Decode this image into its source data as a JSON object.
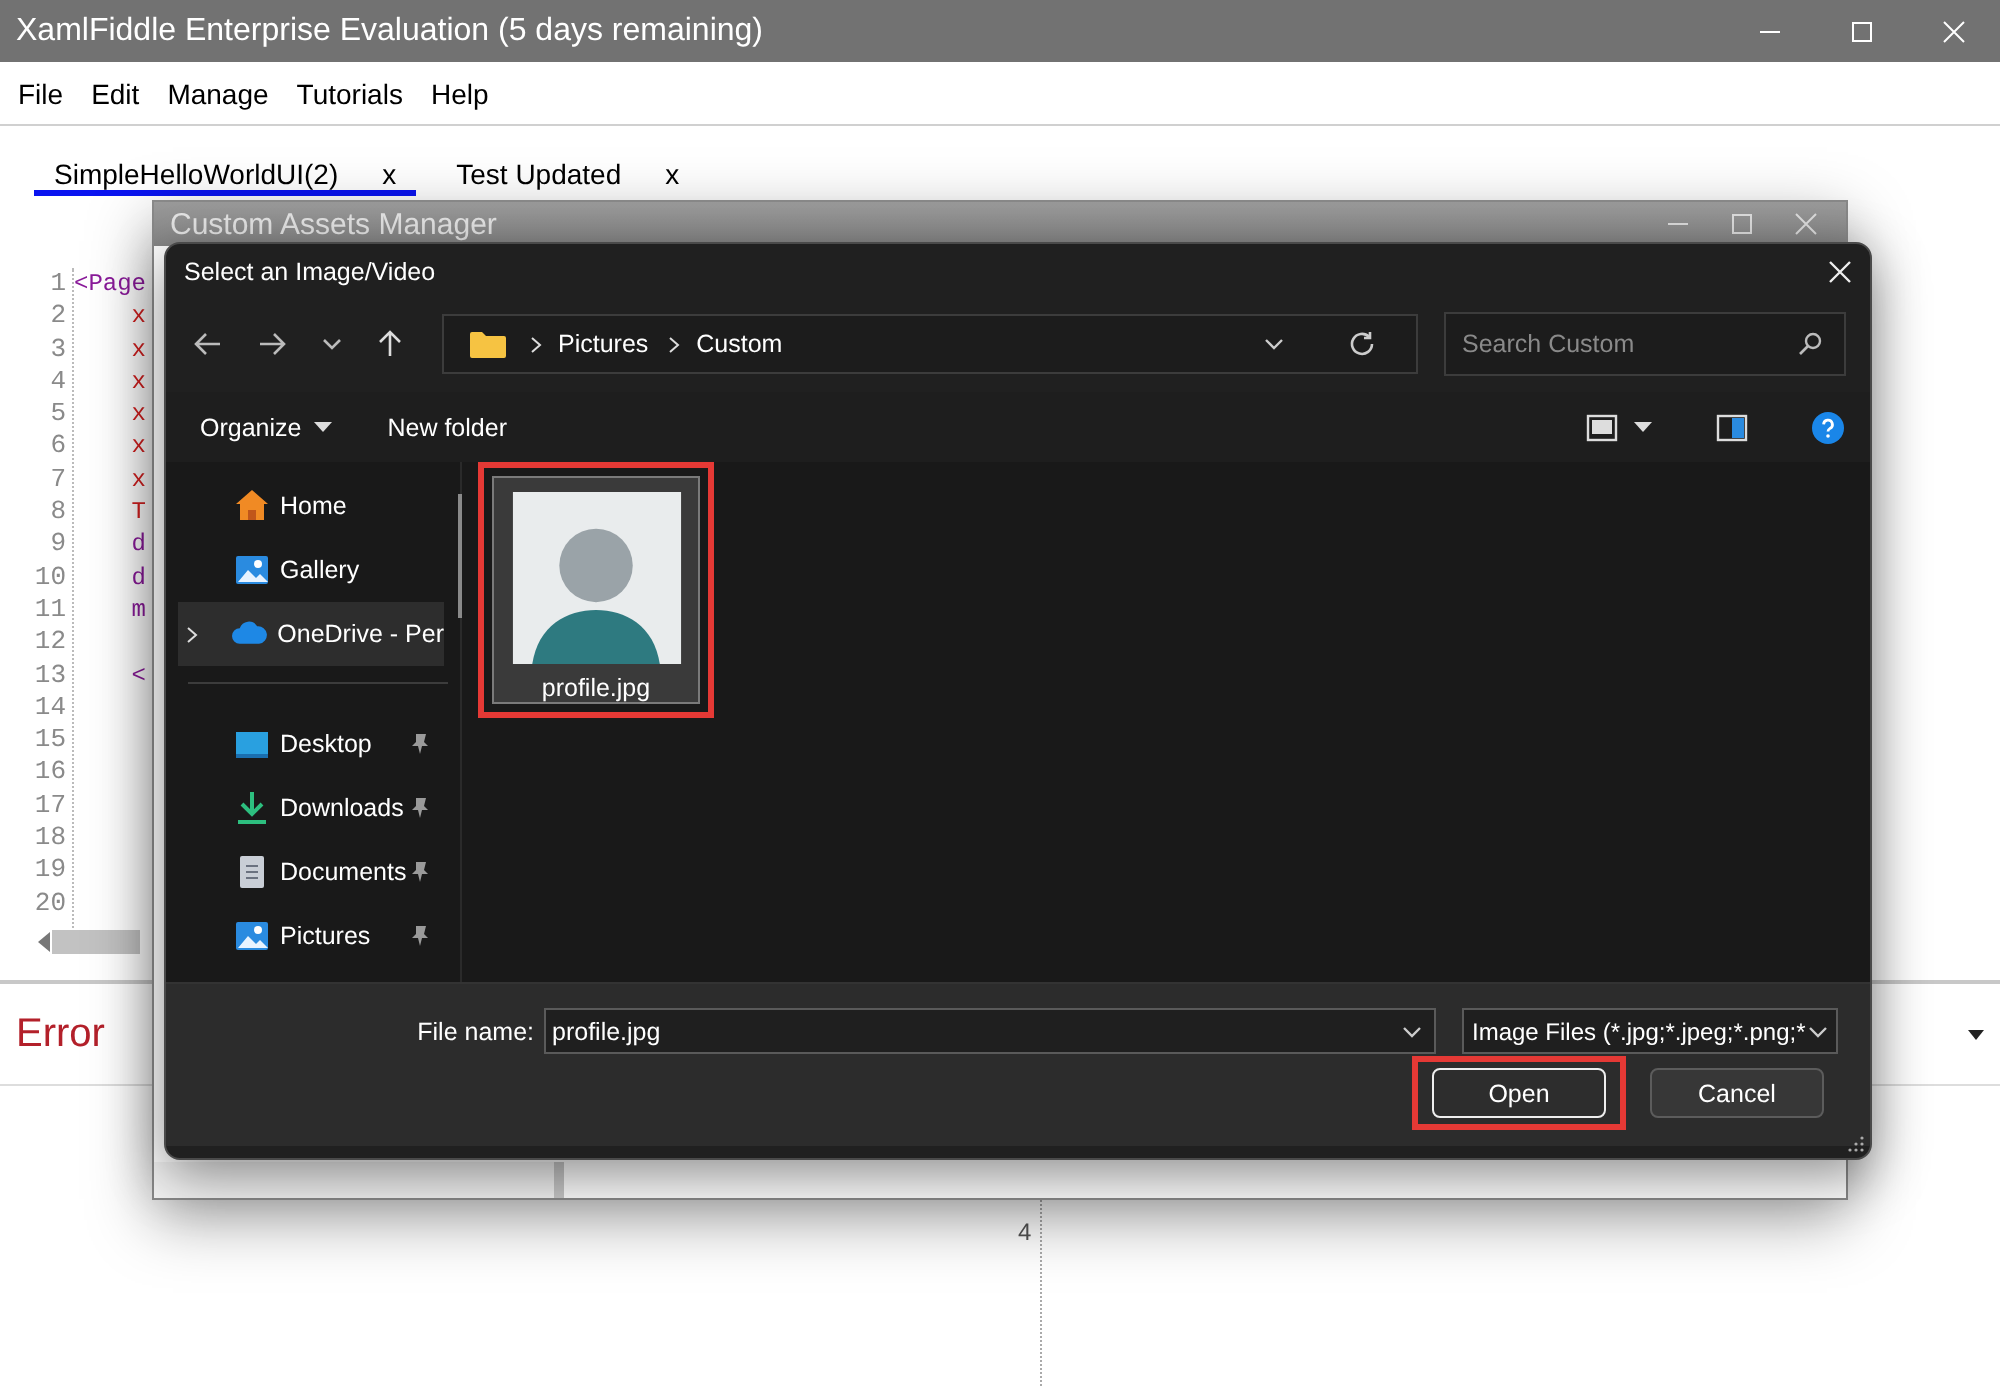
{
  "window": {
    "title": "XamlFiddle Enterprise Evaluation (5 days remaining)"
  },
  "menu": [
    "File",
    "Edit",
    "Manage",
    "Tutorials",
    "Help"
  ],
  "tabs": [
    {
      "label": "SimpleHelloWorldUI(2)",
      "close": "x",
      "selected": true
    },
    {
      "label": "Test Updated",
      "close": "x",
      "selected": false
    }
  ],
  "editor": {
    "lines": [
      {
        "number": "1",
        "code": "<Page",
        "kind": "tag"
      },
      {
        "number": "2",
        "code": "    x",
        "kind": "attribute"
      },
      {
        "number": "3",
        "code": "    x",
        "kind": "attribute"
      },
      {
        "number": "4",
        "code": "    x",
        "kind": "attribute"
      },
      {
        "number": "5",
        "code": "    x",
        "kind": "attribute"
      },
      {
        "number": "6",
        "code": "    x",
        "kind": "attribute"
      },
      {
        "number": "7",
        "code": "    x",
        "kind": "attribute"
      },
      {
        "number": "8",
        "code": "    T",
        "kind": "attribute"
      },
      {
        "number": "9",
        "code": "    d",
        "kind": "tag"
      },
      {
        "number": "10",
        "code": "    d",
        "kind": "tag"
      },
      {
        "number": "11",
        "code": "    m",
        "kind": "tag"
      },
      {
        "number": "12"
      },
      {
        "number": "13",
        "code": "    <",
        "kind": "tag"
      },
      {
        "number": "14"
      },
      {
        "number": "15"
      },
      {
        "number": "16"
      },
      {
        "number": "17"
      },
      {
        "number": "18"
      },
      {
        "number": "19"
      },
      {
        "number": "20"
      }
    ]
  },
  "error_panel": {
    "title": "Error"
  },
  "ruler": {
    "label": "4"
  },
  "assets_window": {
    "title": "Custom Assets Manager"
  },
  "file_dialog": {
    "title": "Select an Image/Video",
    "path": [
      "Pictures",
      "Custom"
    ],
    "search": {
      "placeholder": "Search Custom"
    },
    "toolbar": [
      "Organize",
      "New folder"
    ],
    "sidebar": {
      "items": [
        {
          "label": "Home",
          "kind": "home",
          "selected": false,
          "pinned": false,
          "expandable": false
        },
        {
          "label": "Gallery",
          "kind": "gallery",
          "selected": false,
          "pinned": false,
          "expandable": false
        },
        {
          "label": "OneDrive - Per",
          "kind": "cloud",
          "selected": true,
          "pinned": false,
          "expandable": true
        },
        {
          "label": "Desktop",
          "kind": "desktop",
          "selected": false,
          "pinned": true,
          "expandable": false
        },
        {
          "label": "Downloads",
          "kind": "download",
          "selected": false,
          "pinned": true,
          "expandable": false
        },
        {
          "label": "Documents",
          "kind": "document",
          "selected": false,
          "pinned": true,
          "expandable": false
        },
        {
          "label": "Pictures",
          "kind": "picture",
          "selected": false,
          "pinned": true,
          "expandable": false
        }
      ]
    },
    "files": [
      {
        "name": "profile.jpg",
        "selected": true,
        "highlighted": true
      }
    ],
    "file_name": {
      "label": "File name:",
      "value": "profile.jpg"
    },
    "file_type": {
      "value": "Image Files (*.jpg;*.jpeg;*.png;*"
    },
    "buttons": [
      {
        "label": "Open",
        "kind": "primary",
        "highlighted": true
      },
      {
        "label": "Cancel",
        "kind": "secondary",
        "highlighted": false
      }
    ]
  }
}
